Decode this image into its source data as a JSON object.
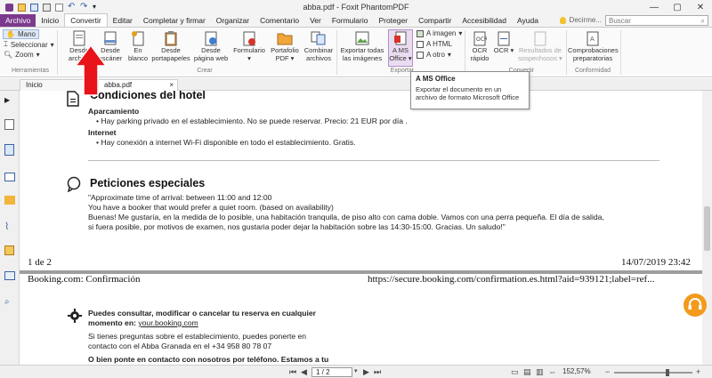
{
  "window": {
    "title": "abba.pdf - Foxit PhantomPDF",
    "minimize": "—",
    "maximize": "▢",
    "close": "✕"
  },
  "menu": {
    "tabs": [
      "Archivo",
      "Inicio",
      "Convertir",
      "Editar",
      "Completar y firmar",
      "Organizar",
      "Comentario",
      "Ver",
      "Formulario",
      "Proteger",
      "Compartir",
      "Accesibilidad",
      "Ayuda"
    ],
    "active_index": 2,
    "tell_me": "Decirme...",
    "search_placeholder": "Buscar"
  },
  "ribbon": {
    "tools": {
      "hand": "Mano",
      "select": "Seleccionar",
      "zoom": "Zoom",
      "label": "Herramientas"
    },
    "create": {
      "from_file": [
        "Desde",
        "archivo"
      ],
      "from_scanner": [
        "Desde",
        "escáner"
      ],
      "blank": [
        "En",
        "blanco"
      ],
      "from_clipboard": [
        "Desde",
        "portapapeles"
      ],
      "from_web": [
        "Desde",
        "página web"
      ],
      "form": [
        "Formulario"
      ],
      "portfolio": [
        "Portafolio",
        "PDF"
      ],
      "combine": [
        "Combinar",
        "archivos"
      ],
      "label": "Crear"
    },
    "export": {
      "all_images": [
        "Exportar todas",
        "las imágenes"
      ],
      "ms_office": [
        "A MS",
        "Office"
      ],
      "to_image": "A imagen",
      "to_html": "A HTML",
      "to_other": "A otro",
      "label": "Exportar"
    },
    "ocr": {
      "quick": [
        "OCR",
        "rápido"
      ],
      "ocr": [
        "OCR"
      ],
      "suspect": [
        "Resultados de",
        "sospechosos"
      ],
      "label": "Convertir"
    },
    "conformity": {
      "preflight": [
        "Comprobaciones",
        "preparatorias"
      ],
      "label": "Conformidad"
    }
  },
  "tooltip": {
    "title": "A MS Office",
    "body": "Exportar el documento en un archivo de formato Microsoft Office"
  },
  "doc_tabs": [
    "Inicio",
    "abba.pdf"
  ],
  "document": {
    "hotel_conditions": {
      "title": "Condiciones del hotel",
      "parking_heading": "Aparcamiento",
      "parking_text": "Hay parking privado en el establecimiento. No se puede reservar. Precio: 21 EUR por día .",
      "internet_heading": "Internet",
      "internet_text": "Hay conexión a internet Wi-Fi disponible en todo el establecimiento. Gratis."
    },
    "special_requests": {
      "title": "Peticiones especiales",
      "lines": [
        "\"Approximate time of arrival: between 11:00 and 12:00",
        "You have a booker that would prefer a quiet room. (based on availability)",
        "Buenas! Me gustaría, en la medida de lo posible, una habitación tranquila, de piso alto con cama doble. Vamos con una perra pequeña. El día de salida,",
        "si fuera posible, por motivos de examen, nos gustaria poder dejar la habitación sobre las 14:30-15:00. Gracias. Un saludo!\""
      ]
    },
    "footer_page": "1 de 2",
    "footer_date": "14/07/2019 23:42",
    "next_header_left": "Booking.com: Confirmación",
    "next_header_right": "https://secure.booking.com/confirmation.es.html?aid=939121;label=ref...",
    "manage": {
      "line1": "Puedes consultar, modificar o cancelar tu reserva en cualquier",
      "line2_prefix": "momento en: ",
      "link": "your.booking.com",
      "line3": "Si tienes preguntas sobre el establecimiento, puedes ponerte en",
      "line4": "contacto con el Abba Granada en el +34 958 80 78 07",
      "line5": "O bien ponte en contacto con nosotros por teléfono. Estamos a tu"
    }
  },
  "status": {
    "page_field": "1 / 2",
    "zoom": "152,57%",
    "zoom_minus": "−",
    "zoom_plus": "+"
  },
  "colors": {
    "file_tab": "#7b3a8e",
    "arrow": "#e8141a",
    "help": "#f39a1c"
  }
}
